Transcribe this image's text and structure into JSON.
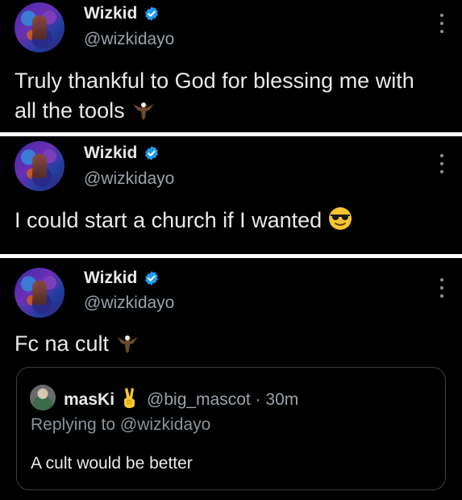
{
  "tweets": [
    {
      "name": "Wizkid",
      "handle": "@wizkidayo",
      "text": "Truly thankful to God for blessing me with all the tools",
      "icons": [
        "avatar",
        "verified-badge-icon",
        "more-options-icon",
        "eagle-emoji"
      ]
    },
    {
      "name": "Wizkid",
      "handle": "@wizkidayo",
      "text": "I could start a church if I wanted",
      "icons": [
        "avatar",
        "verified-badge-icon",
        "more-options-icon",
        "sunglasses-emoji"
      ]
    },
    {
      "name": "Wizkid",
      "handle": "@wizkidayo",
      "text": "Fc na cult",
      "icons": [
        "avatar",
        "verified-badge-icon",
        "more-options-icon",
        "eagle-emoji"
      ],
      "quote": {
        "name": "masKi",
        "handle_time": "@big_mascot · 30m",
        "reply_label": "Replying to",
        "reply_to": "@wizkidayo",
        "text": "A cult would be better",
        "icons": [
          "avatar",
          "victory-hand-emoji"
        ]
      }
    }
  ],
  "colors": {
    "background": "#000000",
    "separator": "#ffffff",
    "text_primary": "#e7e9ea",
    "text_secondary": "#9aa2a9",
    "verified_blue": "#1d9bf0",
    "quote_border": "#3a3f44"
  }
}
